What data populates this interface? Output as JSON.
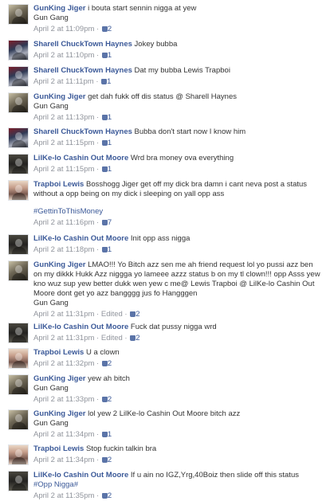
{
  "comments": [
    {
      "author": "GunKing Jiger",
      "text": "i bouta start sennin nigga at yew",
      "subtext": "Gun Gang",
      "time": "April 2 at 11:09pm",
      "sep": " · ",
      "likes": "2"
    },
    {
      "author": "Sharell ChuckTown Haynes",
      "text": "Jokey bubba",
      "time": "April 2 at 11:10pm",
      "sep": " · ",
      "likes": "1"
    },
    {
      "author": "Sharell ChuckTown Haynes",
      "text": "Dat my bubba Lewis Trapboi",
      "time": "April 2 at 11:11pm",
      "sep": " · ",
      "likes": "1"
    },
    {
      "author": "GunKing Jiger",
      "text": "get dah fukk off dis status @ Sharell Haynes",
      "subtext": "Gun Gang",
      "time": "April 2 at 11:13pm",
      "sep": " · ",
      "likes": "1"
    },
    {
      "author": "Sharell ChuckTown Haynes",
      "text": "Bubba don't start now I know him",
      "time": "April 2 at 11:15pm",
      "sep": " · ",
      "likes": "1"
    },
    {
      "author": "LilKe-lo Cashin Out Moore",
      "text": "Wrd bra money ova everything",
      "time": "April 2 at 11:15pm",
      "sep": " · ",
      "likes": "1"
    },
    {
      "author": "Trapboi Lewis",
      "text": "Bosshogg Jiger get off my dick bra damn i cant neva post a status without a opp being on my dick i sleeping on yall opp ass",
      "hashtag": "#GettinToThisMoney",
      "time": "April 2 at 11:16pm",
      "sep": " · ",
      "likes": "7"
    },
    {
      "author": "LilKe-lo Cashin Out Moore",
      "text": "Init opp ass nigga",
      "time": "April 2 at 11:18pm",
      "sep": " · ",
      "likes": "1"
    },
    {
      "author": "GunKing Jiger",
      "text": "LMAO!!! Yo Bitch azz sen me ah friend request lol yo pussi azz ben on my dikkk Hukk Azz niggga yo lameee azzz status b on my tl clown!!! opp Asss yew kno wuz sup yew better dukk wen yew c me@ Lewis Trapboi @ LilKe-lo Cashin Out Moore dont get yo azz bangggg jus fo Hangggen",
      "subtext": "Gun Gang",
      "time": "April 2 at 11:31pm",
      "sep": " · ",
      "edited": "Edited",
      "likes": "2"
    },
    {
      "author": "LilKe-lo Cashin Out Moore",
      "text": "Fuck dat pussy nigga wrd",
      "time": "April 2 at 11:31pm",
      "sep": " · ",
      "edited": "Edited",
      "likes": "2"
    },
    {
      "author": "Trapboi Lewis",
      "text": "U a clown",
      "time": "April 2 at 11:32pm",
      "sep": " · ",
      "likes": "2"
    },
    {
      "author": "GunKing Jiger",
      "text": "yew ah bitch",
      "subtext": "Gun Gang",
      "time": "April 2 at 11:33pm",
      "sep": " · ",
      "likes": "2"
    },
    {
      "author": "GunKing Jiger",
      "text": "lol yew 2 LilKe-lo Cashin Out Moore bitch azz",
      "subtext": "Gun Gang",
      "time": "April 2 at 11:34pm",
      "sep": " · ",
      "likes": "1"
    },
    {
      "author": "Trapboi Lewis",
      "text": "Stop fuckin talkin bra",
      "time": "April 2 at 11:34pm",
      "sep": " · ",
      "likes": "2"
    },
    {
      "author": "LilKe-lo Cashin Out Moore",
      "text": "If u ain no IGZ,Yrg,40Boiz then slide off this status",
      "hashtag": "#Opp Nigga#",
      "time": "April 2 at 11:35pm",
      "sep": " · ",
      "likes": "2"
    }
  ],
  "colors": {
    "link": "#3b5998",
    "meta": "#90949c",
    "text": "#333333"
  },
  "icons": {
    "like": "thumbs-up-icon"
  }
}
